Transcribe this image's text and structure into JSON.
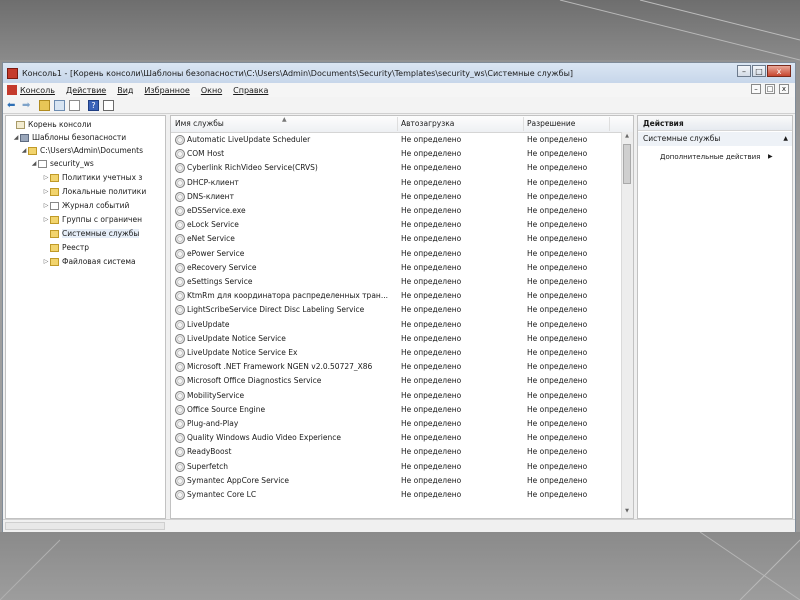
{
  "window": {
    "title": "Консоль1 - [Корень консоли\\Шаблоны безопасности\\C:\\Users\\Admin\\Documents\\Security\\Templates\\security_ws\\Системные службы]",
    "controls": {
      "minimize": "–",
      "maximize": "□",
      "close": "x"
    }
  },
  "menu": {
    "items": [
      "Консоль",
      "Действие",
      "Вид",
      "Избранное",
      "Окно",
      "Справка"
    ],
    "inner_controls": {
      "minimize": "–",
      "restore": "□",
      "close": "x"
    }
  },
  "toolbar": {
    "back": "⬅",
    "forward": "➡",
    "help": "?"
  },
  "tree": {
    "nodes": [
      {
        "label": "Корень консоли",
        "twisty": "",
        "icon": "root-folder-icon"
      },
      {
        "label": "Шаблоны безопасности",
        "twisty": "◢",
        "icon": "security-templates-icon"
      },
      {
        "label": "C:\\Users\\Admin\\Documents",
        "twisty": "◢",
        "icon": "folder-icon"
      },
      {
        "label": "security_ws",
        "twisty": "◢",
        "icon": "template-icon"
      },
      {
        "label": "Политики учетных з",
        "twisty": "▷",
        "icon": "folder-icon"
      },
      {
        "label": "Локальные политики",
        "twisty": "▷",
        "icon": "folder-icon"
      },
      {
        "label": "Журнал событий",
        "twisty": "▷",
        "icon": "log-icon"
      },
      {
        "label": "Группы с ограничен",
        "twisty": "▷",
        "icon": "folder-icon"
      },
      {
        "label": "Системные службы",
        "twisty": "",
        "icon": "folder-icon"
      },
      {
        "label": "Реестр",
        "twisty": "",
        "icon": "folder-icon"
      },
      {
        "label": "Файловая система",
        "twisty": "▷",
        "icon": "folder-icon"
      }
    ]
  },
  "list": {
    "columns": [
      "Имя службы",
      "Автозагрузка",
      "Разрешение"
    ],
    "rows": [
      {
        "name": "Automatic LiveUpdate Scheduler",
        "startup": "Не определено",
        "permission": "Не определено"
      },
      {
        "name": "COM Host",
        "startup": "Не определено",
        "permission": "Не определено"
      },
      {
        "name": "Cyberlink RichVideo Service(CRVS)",
        "startup": "Не определено",
        "permission": "Не определено"
      },
      {
        "name": "DHCP-клиент",
        "startup": "Не определено",
        "permission": "Не определено"
      },
      {
        "name": "DNS-клиент",
        "startup": "Не определено",
        "permission": "Не определено"
      },
      {
        "name": "eDSService.exe",
        "startup": "Не определено",
        "permission": "Не определено"
      },
      {
        "name": "eLock Service",
        "startup": "Не определено",
        "permission": "Не определено"
      },
      {
        "name": "eNet Service",
        "startup": "Не определено",
        "permission": "Не определено"
      },
      {
        "name": "ePower Service",
        "startup": "Не определено",
        "permission": "Не определено"
      },
      {
        "name": "eRecovery Service",
        "startup": "Не определено",
        "permission": "Не определено"
      },
      {
        "name": "eSettings Service",
        "startup": "Не определено",
        "permission": "Не определено"
      },
      {
        "name": "KtmRm для координатора распределенных тран...",
        "startup": "Не определено",
        "permission": "Не определено"
      },
      {
        "name": "LightScribeService Direct Disc Labeling Service",
        "startup": "Не определено",
        "permission": "Не определено"
      },
      {
        "name": "LiveUpdate",
        "startup": "Не определено",
        "permission": "Не определено"
      },
      {
        "name": "LiveUpdate Notice Service",
        "startup": "Не определено",
        "permission": "Не определено"
      },
      {
        "name": "LiveUpdate Notice Service Ex",
        "startup": "Не определено",
        "permission": "Не определено"
      },
      {
        "name": "Microsoft .NET Framework NGEN v2.0.50727_X86",
        "startup": "Не определено",
        "permission": "Не определено"
      },
      {
        "name": "Microsoft Office Diagnostics Service",
        "startup": "Не определено",
        "permission": "Не определено"
      },
      {
        "name": "MobilityService",
        "startup": "Не определено",
        "permission": "Не определено"
      },
      {
        "name": "Office Source Engine",
        "startup": "Не определено",
        "permission": "Не определено"
      },
      {
        "name": "Plug-and-Play",
        "startup": "Не определено",
        "permission": "Не определено"
      },
      {
        "name": "Quality Windows Audio Video Experience",
        "startup": "Не определено",
        "permission": "Не определено"
      },
      {
        "name": "ReadyBoost",
        "startup": "Не определено",
        "permission": "Не определено"
      },
      {
        "name": "Superfetch",
        "startup": "Не определено",
        "permission": "Не определено"
      },
      {
        "name": "Symantec AppCore Service",
        "startup": "Не определено",
        "permission": "Не определено"
      },
      {
        "name": "Symantec Core LC",
        "startup": "Не определено",
        "permission": "Не определено"
      }
    ]
  },
  "actions": {
    "title": "Действия",
    "section": "Системные службы",
    "item": "Дополнительные действия"
  },
  "colors": {
    "accent": "#c43a2c",
    "selection": "#e6eef8"
  }
}
